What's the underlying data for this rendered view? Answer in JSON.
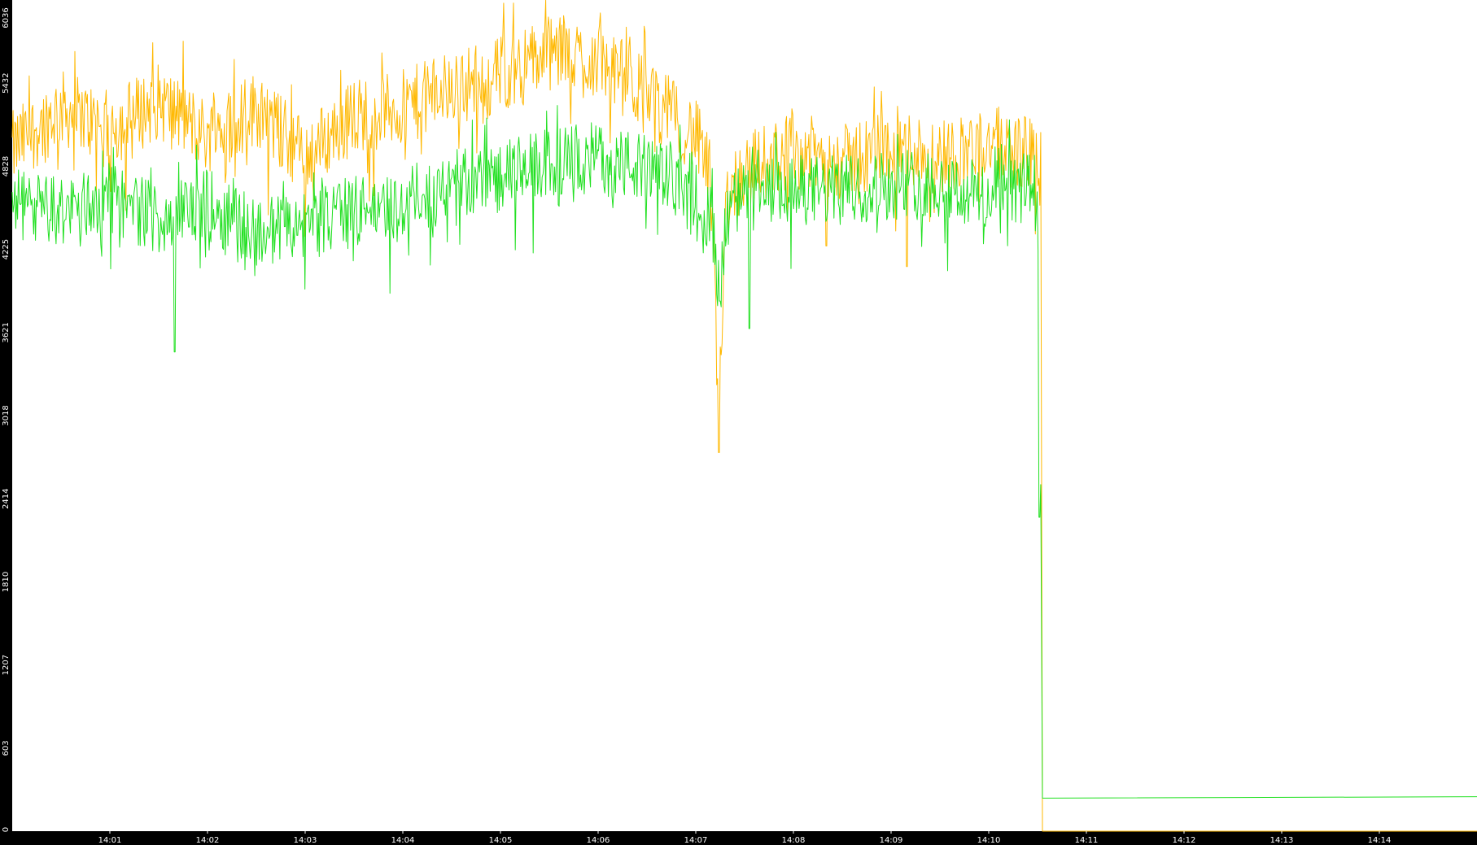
{
  "chart_data": {
    "type": "line",
    "title": "",
    "xlabel": "",
    "ylabel": "",
    "grid": false,
    "legend": "none",
    "colors": {
      "background": "#000000",
      "plot_area": "#ffffff",
      "axis_text": "#ffffff"
    },
    "xlim": [
      "14:00",
      "14:15"
    ],
    "ylim": [
      0,
      6036
    ],
    "y_ticks": [
      0,
      603,
      1207,
      1810,
      2414,
      3018,
      3621,
      4225,
      4828,
      5432,
      6036
    ],
    "y_tick_labels": [
      "0",
      "603",
      "1207",
      "1810",
      "2414",
      "3018",
      "3621",
      "4225",
      "4828",
      "5432",
      "6036"
    ],
    "x_ticks": [
      "14:01",
      "14:02",
      "14:03",
      "14:04",
      "14:05",
      "14:06",
      "14:07",
      "14:08",
      "14:09",
      "14:10",
      "14:11",
      "14:12",
      "14:13",
      "14:14"
    ],
    "series": [
      {
        "color": "#ffb800",
        "x": [
          "14:00:00",
          "14:00:30",
          "14:01:00",
          "14:01:30",
          "14:02:00",
          "14:02:30",
          "14:03:00",
          "14:03:30",
          "14:04:00",
          "14:04:30",
          "14:05:00",
          "14:05:30",
          "14:06:00",
          "14:06:30",
          "14:07:00",
          "14:07:10",
          "14:07:14",
          "14:07:18",
          "14:07:30",
          "14:08:00",
          "14:08:30",
          "14:09:00",
          "14:09:30",
          "14:10:00",
          "14:10:30",
          "14:10:32",
          "14:10:33",
          "14:15:00"
        ],
        "values": [
          4950,
          5250,
          5100,
          5300,
          5050,
          5250,
          4900,
          5200,
          5250,
          5400,
          5500,
          5650,
          5600,
          5350,
          5050,
          4700,
          2800,
          4600,
          4800,
          4950,
          4850,
          5000,
          4900,
          5000,
          4900,
          4900,
          0,
          0
        ],
        "jitter": 280,
        "dips": [
          {
            "x": "14:07:14",
            "value": 2750
          },
          {
            "x": "14:08:20",
            "value": 4250
          },
          {
            "x": "14:09:10",
            "value": 4100
          }
        ]
      },
      {
        "color": "#22e022",
        "x": [
          "14:00:00",
          "14:00:30",
          "14:01:00",
          "14:01:30",
          "14:02:00",
          "14:02:30",
          "14:03:00",
          "14:03:30",
          "14:04:00",
          "14:04:30",
          "14:05:00",
          "14:05:30",
          "14:06:00",
          "14:06:30",
          "14:07:00",
          "14:07:10",
          "14:07:14",
          "14:07:18",
          "14:07:30",
          "14:08:00",
          "14:08:30",
          "14:09:00",
          "14:09:30",
          "14:10:00",
          "14:10:30",
          "14:10:31",
          "14:10:32",
          "14:10:33",
          "14:15:00"
        ],
        "values": [
          4550,
          4500,
          4600,
          4450,
          4550,
          4350,
          4400,
          4500,
          4550,
          4700,
          4750,
          4850,
          4900,
          4800,
          4700,
          4400,
          3900,
          4500,
          4600,
          4650,
          4650,
          4700,
          4700,
          4600,
          4700,
          2400,
          2400,
          240,
          250
        ],
        "jitter": 260,
        "dips": [
          {
            "x": "14:01:40",
            "value": 3480
          },
          {
            "x": "14:07:15",
            "value": 3850
          },
          {
            "x": "14:07:33",
            "value": 3650
          },
          {
            "x": "14:10:31",
            "value": 2280
          }
        ]
      }
    ]
  }
}
